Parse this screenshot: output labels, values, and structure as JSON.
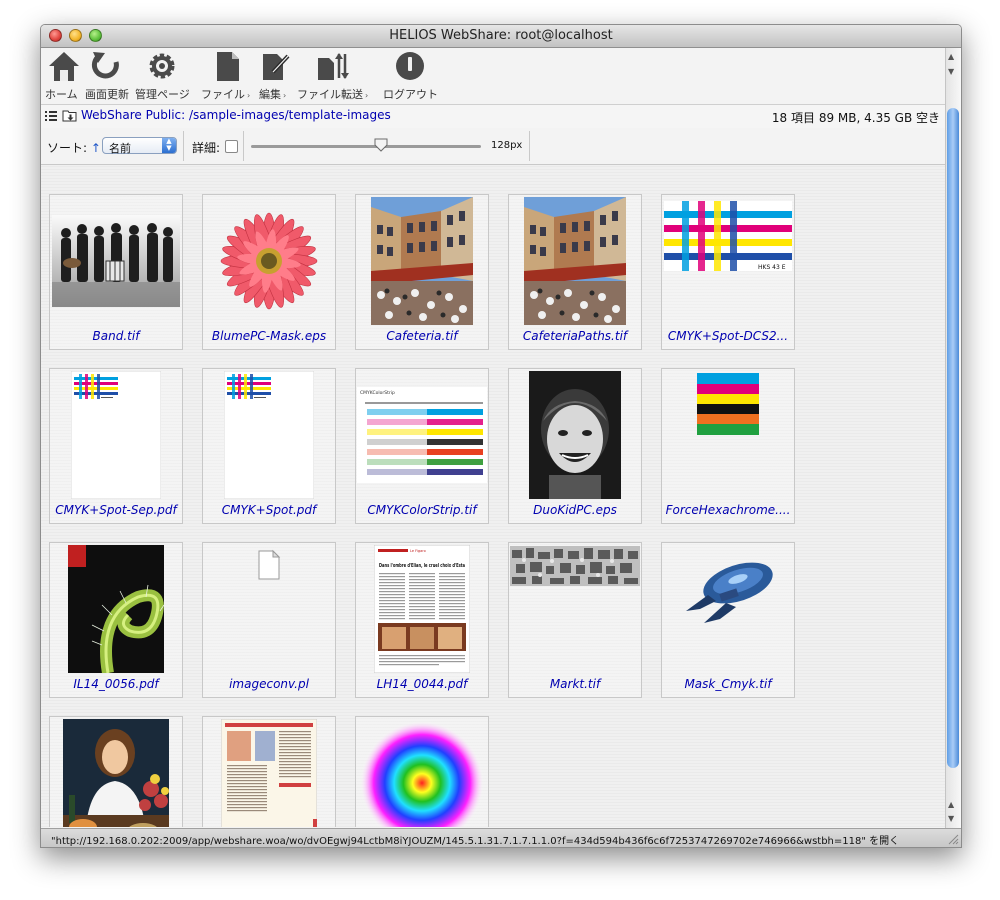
{
  "window": {
    "title": "HELIOS WebShare: root@localhost"
  },
  "toolbar": {
    "items": [
      {
        "label": "ホーム",
        "icon": "home-icon",
        "menu": false
      },
      {
        "label": "画面更新",
        "icon": "refresh-icon",
        "menu": false
      },
      {
        "label": "管理ページ",
        "icon": "gear-icon",
        "menu": false
      },
      {
        "label": "ファイル",
        "icon": "document-icon",
        "menu": true
      },
      {
        "label": "編集",
        "icon": "edit-icon",
        "menu": true
      },
      {
        "label": "ファイル転送",
        "icon": "transfer-icon",
        "menu": true
      },
      {
        "label": "ログアウト",
        "icon": "logout-icon",
        "menu": false
      }
    ],
    "menu_arrow": "›"
  },
  "path": {
    "text": "WebShare Public: /sample-images/template-images",
    "info": "18 項目 89 MB, 4.35 GB 空き"
  },
  "controls": {
    "sort_label": "ソート:",
    "sort_direction": "↑",
    "sort_value": "名前",
    "detail_label": "詳細:",
    "detail_checked": false,
    "thumb_size": "128px"
  },
  "files": [
    {
      "name": "Band.tif"
    },
    {
      "name": "BlumePC-Mask.eps"
    },
    {
      "name": "Cafeteria.tif"
    },
    {
      "name": "CafeteriaPaths.tif"
    },
    {
      "name": "CMYK+Spot-DCS2..."
    },
    {
      "name": "CMYK+Spot-Sep.pdf"
    },
    {
      "name": "CMYK+Spot.pdf"
    },
    {
      "name": "CMYKColorStrip.tif"
    },
    {
      "name": "DuoKidPC.eps"
    },
    {
      "name": "ForceHexachrome...."
    },
    {
      "name": "IL14_0056.pdf"
    },
    {
      "name": "imageconv.pl"
    },
    {
      "name": "LH14_0044.pdf"
    },
    {
      "name": "Markt.tif"
    },
    {
      "name": "Mask_Cmyk.tif"
    },
    {
      "name": ""
    },
    {
      "name": ""
    },
    {
      "name": ""
    }
  ],
  "thumb_text": {
    "hks": "HKS 43 E",
    "strip_header": "CMYKColorStrip",
    "lh_headline": "Dans l'ombre d'Elian, le cruel choix d'Esta",
    "lh_tag": "Le Figaro"
  },
  "status": {
    "text": "\"http://192.168.0.202:2009/app/webshare.woa/wo/dvOEgwj94LctbM8iYJOUZM/145.5.1.31.7.1.7.1.1.0?f=434d594b436f6c6f7253747269702e746966&wstbh=118\" を開く"
  },
  "colors": {
    "link": "#0000b0",
    "cyan": "#00a0e0",
    "magenta": "#e0007a",
    "yellow": "#ffe600",
    "blue": "#1f4fa8"
  }
}
